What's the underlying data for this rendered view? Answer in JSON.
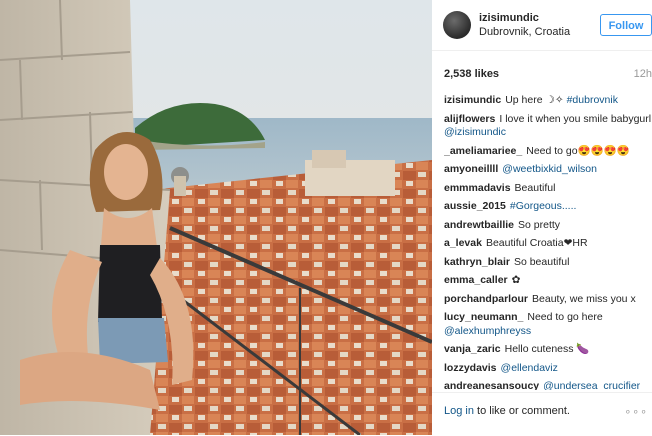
{
  "post": {
    "username": "izisimundic",
    "location": "Dubrovnik, Croatia",
    "follow_label": "Follow",
    "likes": "2,538 likes",
    "time": "12h"
  },
  "comments": [
    {
      "user": "izisimundic",
      "text": "Up here ☽✧ ",
      "tag": "#dubrovnik"
    },
    {
      "user": "alijflowers",
      "text": "I love it when you smile babygurl ",
      "tag": "@izisimundic"
    },
    {
      "user": "_ameliamariee_",
      "text": "Need to go😍😍😍😍",
      "tag": ""
    },
    {
      "user": "amyoneillll",
      "text": "",
      "tag": "@weetbixkid_wilson"
    },
    {
      "user": "emmmadavis",
      "text": "Beautiful",
      "tag": ""
    },
    {
      "user": "aussie_2015",
      "text": "",
      "tag": "#Gorgeous....."
    },
    {
      "user": "andrewtbaillie",
      "text": "So pretty",
      "tag": ""
    },
    {
      "user": "a_levak",
      "text": "Beautiful Croatia❤HR",
      "tag": ""
    },
    {
      "user": "kathryn_blair",
      "text": "So beautiful",
      "tag": ""
    },
    {
      "user": "emma_caller",
      "text": "✿",
      "tag": ""
    },
    {
      "user": "porchandparlour",
      "text": "Beauty, we miss you x",
      "tag": ""
    },
    {
      "user": "lucy_neumann_",
      "text": "Need to go here ",
      "tag": "@alexhumphreyss"
    },
    {
      "user": "vanja_zaric",
      "text": "Hello cuteness 🍆",
      "tag": ""
    },
    {
      "user": "lozzydavis",
      "text": "",
      "tag": "@ellendaviz"
    },
    {
      "user": "andreanesansoucy",
      "text": "",
      "tag": "@undersea_crucifier"
    }
  ],
  "footer": {
    "login_link": "Log in",
    "login_rest": " to like or comment.",
    "more": "∘∘∘"
  },
  "colors": {
    "link_blue": "#125688",
    "follow_blue": "#3897f0",
    "muted": "#999999"
  }
}
